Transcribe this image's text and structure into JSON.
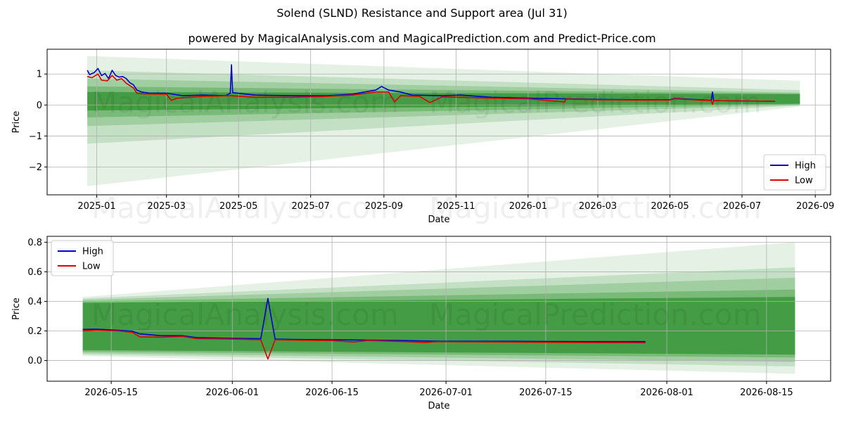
{
  "header": {
    "title": "Solend (SLND) Resistance and Support area (Jul 31)",
    "subtitle": "powered by MagicalAnalysis.com and MagicalPrediction.com and Predict-Price.com"
  },
  "watermarks": [
    "MagicalAnalysis.com",
    "MagicalPrediction.com"
  ],
  "colors": {
    "high": "#0000cc",
    "low": "#dd0000",
    "band": "#228b22",
    "grid": "#b0b0b0"
  },
  "chart_data": [
    {
      "type": "line",
      "xlabel": "Date",
      "ylabel": "Price",
      "grid": true,
      "legend": "bottom-right",
      "xticks": [
        "2025-01",
        "2025-03",
        "2025-05",
        "2025-07",
        "2025-09",
        "2025-11",
        "2026-01",
        "2026-03",
        "2026-05",
        "2026-07",
        "2026-09"
      ],
      "yticks": [
        "1",
        "0",
        "−1",
        "−2"
      ],
      "ylim": [
        -2.9,
        1.8
      ],
      "series": [
        {
          "name": "High",
          "points": [
            [
              "2024-12-24",
              1.12
            ],
            [
              "2024-12-26",
              0.98
            ],
            [
              "2024-12-30",
              1.05
            ],
            [
              "2025-01-02",
              1.18
            ],
            [
              "2025-01-05",
              0.95
            ],
            [
              "2025-01-08",
              1.02
            ],
            [
              "2025-01-11",
              0.85
            ],
            [
              "2025-01-14",
              1.12
            ],
            [
              "2025-01-17",
              0.95
            ],
            [
              "2025-01-20",
              0.9
            ],
            [
              "2025-01-23",
              0.92
            ],
            [
              "2025-01-26",
              0.85
            ],
            [
              "2025-01-29",
              0.72
            ],
            [
              "2025-02-01",
              0.65
            ],
            [
              "2025-02-04",
              0.48
            ],
            [
              "2025-02-08",
              0.42
            ],
            [
              "2025-02-15",
              0.38
            ],
            [
              "2025-03-01",
              0.38
            ],
            [
              "2025-03-15",
              0.3
            ],
            [
              "2025-04-01",
              0.32
            ],
            [
              "2025-04-20",
              0.3
            ],
            [
              "2025-04-24",
              0.38
            ],
            [
              "2025-04-25",
              1.3
            ],
            [
              "2025-04-26",
              0.4
            ],
            [
              "2025-05-15",
              0.32
            ],
            [
              "2025-06-15",
              0.3
            ],
            [
              "2025-07-15",
              0.3
            ],
            [
              "2025-08-05",
              0.35
            ],
            [
              "2025-08-25",
              0.48
            ],
            [
              "2025-08-30",
              0.6
            ],
            [
              "2025-09-05",
              0.48
            ],
            [
              "2025-09-15",
              0.42
            ],
            [
              "2025-09-25",
              0.32
            ],
            [
              "2025-10-20",
              0.3
            ],
            [
              "2025-11-05",
              0.32
            ],
            [
              "2025-12-01",
              0.25
            ],
            [
              "2026-01-01",
              0.22
            ],
            [
              "2026-02-01",
              0.2
            ],
            [
              "2026-03-01",
              0.18
            ],
            [
              "2026-04-01",
              0.17
            ],
            [
              "2026-05-01",
              0.17
            ],
            [
              "2026-05-05",
              0.21
            ],
            [
              "2026-06-05",
              0.15
            ],
            [
              "2026-06-06",
              0.42
            ],
            [
              "2026-06-07",
              0.14
            ],
            [
              "2026-06-30",
              0.13
            ],
            [
              "2026-07-29",
              0.12
            ]
          ]
        },
        {
          "name": "Low",
          "points": [
            [
              "2024-12-24",
              0.92
            ],
            [
              "2024-12-28",
              0.88
            ],
            [
              "2025-01-02",
              1.0
            ],
            [
              "2025-01-05",
              0.8
            ],
            [
              "2025-01-10",
              0.78
            ],
            [
              "2025-01-14",
              0.95
            ],
            [
              "2025-01-18",
              0.8
            ],
            [
              "2025-01-22",
              0.85
            ],
            [
              "2025-01-26",
              0.7
            ],
            [
              "2025-02-01",
              0.55
            ],
            [
              "2025-02-04",
              0.38
            ],
            [
              "2025-02-10",
              0.36
            ],
            [
              "2025-03-01",
              0.35
            ],
            [
              "2025-03-05",
              0.15
            ],
            [
              "2025-03-10",
              0.22
            ],
            [
              "2025-04-01",
              0.28
            ],
            [
              "2025-04-25",
              0.3
            ],
            [
              "2025-05-15",
              0.25
            ],
            [
              "2025-06-15",
              0.25
            ],
            [
              "2025-07-15",
              0.28
            ],
            [
              "2025-08-05",
              0.32
            ],
            [
              "2025-08-25",
              0.42
            ],
            [
              "2025-09-05",
              0.42
            ],
            [
              "2025-09-10",
              0.1
            ],
            [
              "2025-09-15",
              0.3
            ],
            [
              "2025-10-01",
              0.28
            ],
            [
              "2025-10-10",
              0.08
            ],
            [
              "2025-10-20",
              0.26
            ],
            [
              "2025-11-05",
              0.25
            ],
            [
              "2025-12-01",
              0.22
            ],
            [
              "2026-01-01",
              0.2
            ],
            [
              "2026-02-01",
              0.1
            ],
            [
              "2026-02-02",
              0.19
            ],
            [
              "2026-03-01",
              0.17
            ],
            [
              "2026-04-01",
              0.16
            ],
            [
              "2026-05-01",
              0.16
            ],
            [
              "2026-05-05",
              0.2
            ],
            [
              "2026-06-05",
              0.14
            ],
            [
              "2026-06-06",
              0.02
            ],
            [
              "2026-06-07",
              0.14
            ],
            [
              "2026-06-30",
              0.13
            ],
            [
              "2026-07-29",
              0.12
            ]
          ]
        }
      ]
    },
    {
      "type": "line",
      "xlabel": "Date",
      "ylabel": "Price",
      "grid": true,
      "legend": "top-left",
      "xticks": [
        "2026-05-15",
        "2026-06-01",
        "2026-06-15",
        "2026-07-01",
        "2026-07-15",
        "2026-08-01",
        "2026-08-15"
      ],
      "yticks": [
        "0.8",
        "0.6",
        "0.4",
        "0.2",
        "0.0"
      ],
      "ylim": [
        -0.14,
        0.84
      ],
      "series": [
        {
          "name": "High",
          "points": [
            [
              "2026-05-11",
              0.21
            ],
            [
              "2026-05-13",
              0.212
            ],
            [
              "2026-05-16",
              0.205
            ],
            [
              "2026-05-18",
              0.198
            ],
            [
              "2026-05-19",
              0.18
            ],
            [
              "2026-05-22",
              0.168
            ],
            [
              "2026-05-25",
              0.168
            ],
            [
              "2026-05-27",
              0.155
            ],
            [
              "2026-06-01",
              0.15
            ],
            [
              "2026-06-05",
              0.148
            ],
            [
              "2026-06-06",
              0.42
            ],
            [
              "2026-06-07",
              0.145
            ],
            [
              "2026-06-10",
              0.142
            ],
            [
              "2026-06-15",
              0.14
            ],
            [
              "2026-06-20",
              0.138
            ],
            [
              "2026-06-25",
              0.135
            ],
            [
              "2026-06-30",
              0.13
            ],
            [
              "2026-07-10",
              0.13
            ],
            [
              "2026-07-20",
              0.128
            ],
            [
              "2026-07-29",
              0.128
            ]
          ]
        },
        {
          "name": "Low",
          "points": [
            [
              "2026-05-11",
              0.2
            ],
            [
              "2026-05-13",
              0.205
            ],
            [
              "2026-05-16",
              0.2
            ],
            [
              "2026-05-18",
              0.19
            ],
            [
              "2026-05-19",
              0.16
            ],
            [
              "2026-05-22",
              0.158
            ],
            [
              "2026-05-25",
              0.163
            ],
            [
              "2026-05-27",
              0.148
            ],
            [
              "2026-06-01",
              0.145
            ],
            [
              "2026-06-05",
              0.14
            ],
            [
              "2026-06-06",
              0.01
            ],
            [
              "2026-06-07",
              0.14
            ],
            [
              "2026-06-10",
              0.138
            ],
            [
              "2026-06-15",
              0.135
            ],
            [
              "2026-06-18",
              0.125
            ],
            [
              "2026-06-20",
              0.135
            ],
            [
              "2026-06-25",
              0.128
            ],
            [
              "2026-06-28",
              0.122
            ],
            [
              "2026-06-30",
              0.128
            ],
            [
              "2026-07-10",
              0.125
            ],
            [
              "2026-07-20",
              0.122
            ],
            [
              "2026-07-29",
              0.12
            ]
          ]
        }
      ]
    }
  ]
}
